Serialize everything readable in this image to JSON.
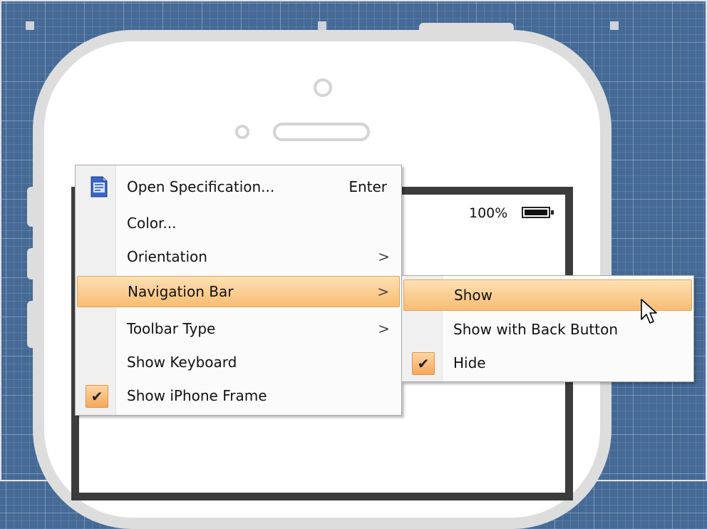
{
  "phone": {
    "battery_percent": "100%"
  },
  "context_menu": {
    "items": [
      {
        "label": "Open Specification...",
        "shortcut": "Enter",
        "icon": "specification-icon"
      },
      {
        "label": "Color..."
      },
      {
        "label": "Orientation",
        "submenu_arrow": ">"
      },
      {
        "label": "Navigation Bar",
        "submenu_arrow": ">",
        "highlighted": true
      },
      {
        "label": "Toolbar Type",
        "submenu_arrow": ">"
      },
      {
        "label": "Show Keyboard"
      },
      {
        "label": "Show iPhone Frame",
        "checked": true,
        "check_mark": "✔"
      }
    ]
  },
  "submenu": {
    "items": [
      {
        "label": "Show",
        "highlighted": true
      },
      {
        "label": "Show with Back Button"
      },
      {
        "label": "Hide",
        "checked": true,
        "check_mark": "✔"
      }
    ]
  },
  "colors": {
    "canvas_background": "#456a96",
    "highlight_top": "#fde0b4",
    "highlight_bottom": "#f8bd72",
    "phone_frame": "#dddddd",
    "screen_border": "#3c3c3c"
  }
}
